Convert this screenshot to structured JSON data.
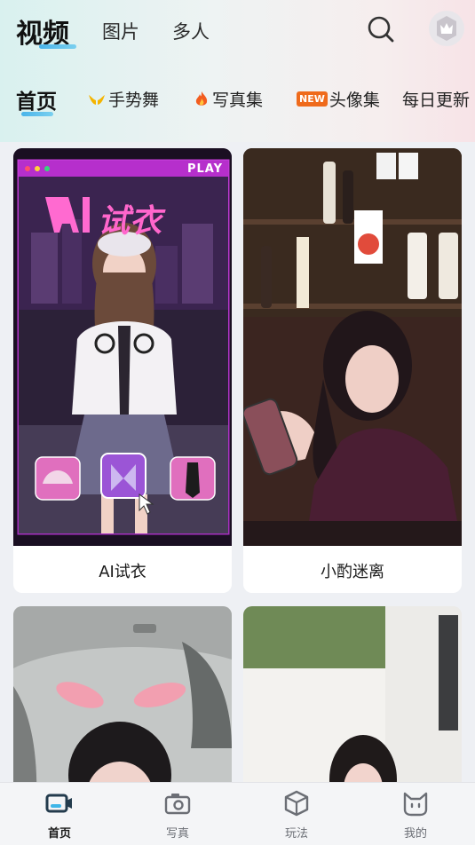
{
  "top_tabs": {
    "video": "视频",
    "photo": "图片",
    "multi": "多人"
  },
  "sub_tabs": {
    "home": "首页",
    "gesture_dance": "手势舞",
    "photo_album": "写真集",
    "avatar_set": "头像集",
    "avatar_badge": "NEW",
    "daily_update": "每日更新"
  },
  "cards": [
    {
      "caption": "AI试衣",
      "title_art": "AI试衣",
      "play": "PLAY"
    },
    {
      "caption": "小酌迷离"
    },
    {
      "caption": ""
    },
    {
      "caption": ""
    }
  ],
  "bottom_nav": {
    "home": "首页",
    "photo": "写真",
    "play": "玩法",
    "mine": "我的"
  },
  "colors": {
    "accent": "#49b4ea",
    "active_text": "#111111",
    "badge": "#ef6a1b"
  }
}
